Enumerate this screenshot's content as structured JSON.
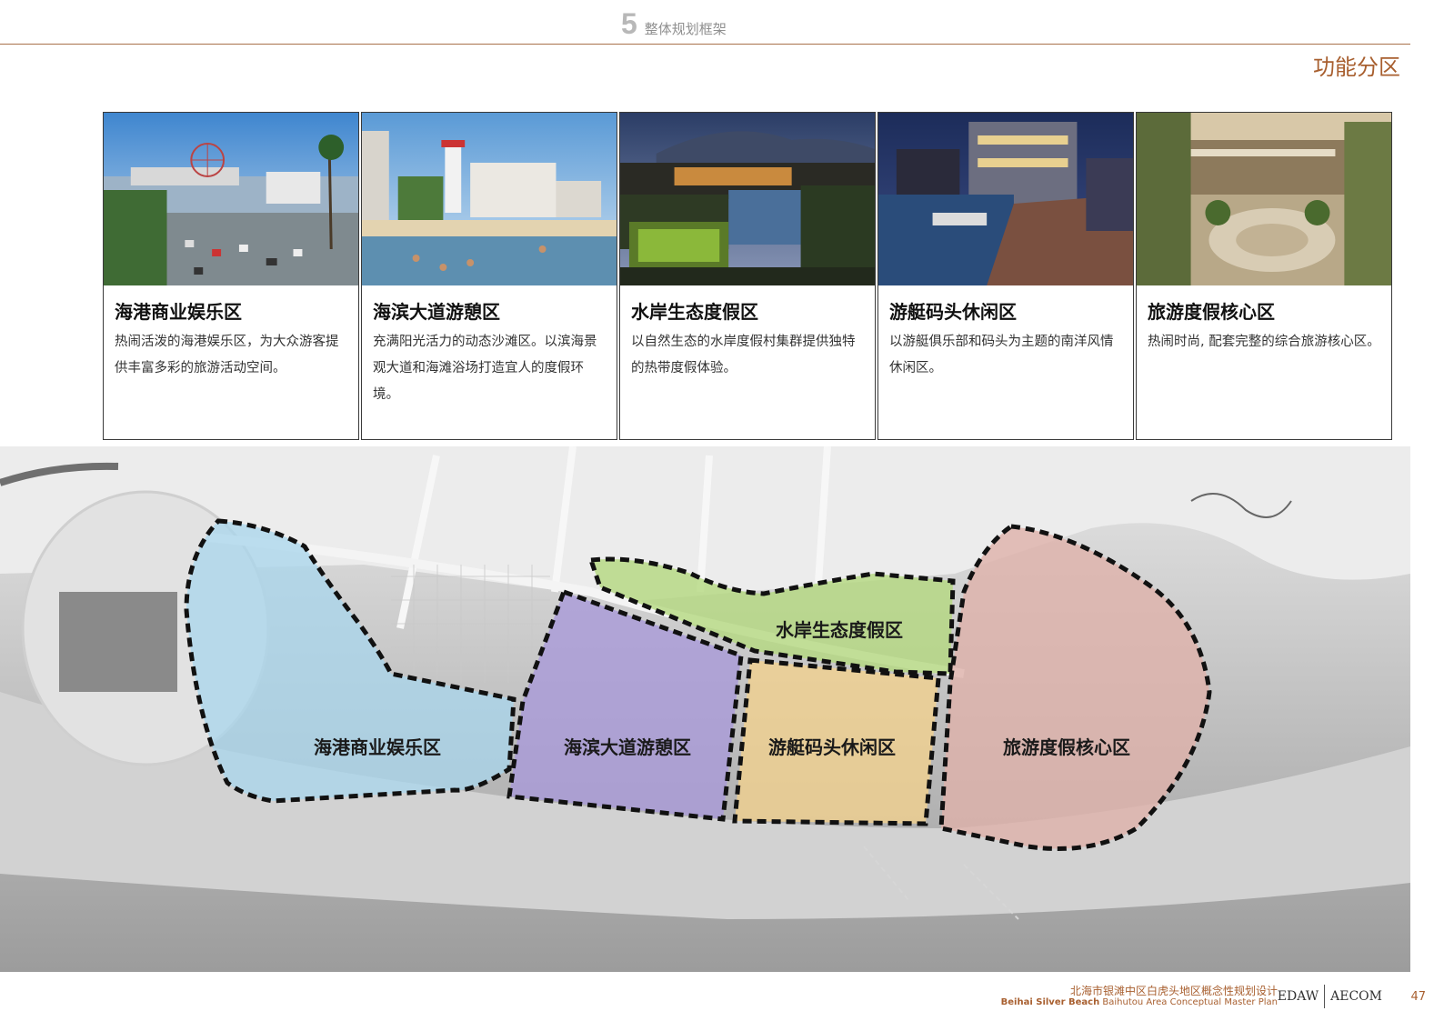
{
  "header": {
    "section_number": "5",
    "section_title": "整体规划框架",
    "page_heading": "功能分区"
  },
  "cards": [
    {
      "title": "海港商业娱乐区",
      "desc": "热闹活泼的海港娱乐区，为大众游客提供丰富多彩的旅游活动空间。",
      "photo": "harbor-pier-ferris-wheel"
    },
    {
      "title": "海滨大道游憩区",
      "desc": "充满阳光活力的动态沙滩区。以滨海景观大道和海滩浴场打造宜人的度假环境。",
      "photo": "beach-resort-hotels"
    },
    {
      "title": "水岸生态度假区",
      "desc": "以自然生态的水岸度假村集群提供独特的热带度假体验。",
      "photo": "waterfront-resort-night"
    },
    {
      "title": "游艇码头休闲区",
      "desc": "以游艇俱乐部和码头为主题的南洋风情休闲区。",
      "photo": "marina-night"
    },
    {
      "title": "旅游度假核心区",
      "desc": "热闹时尚, 配套完整的综合旅游核心区。",
      "photo": "plaza-palms"
    }
  ],
  "map": {
    "zones": [
      {
        "name": "海港商业娱乐区",
        "color": "#a8d6ec"
      },
      {
        "name": "水岸生态度假区",
        "color": "#b4d880"
      },
      {
        "name": "海滨大道游憩区",
        "color": "#a99ad8"
      },
      {
        "name": "游艇码头休闲区",
        "color": "#f1d18f"
      },
      {
        "name": "旅游度假核心区",
        "color": "#dfb2aa"
      }
    ]
  },
  "footer": {
    "title_cn": "北海市银滩中区白虎头地区概念性规划设计",
    "title_en_bold": "Beihai Silver Beach",
    "title_en_rest": " Baihutou Area Conceptual Master Plan",
    "logo_left": "EDAW",
    "logo_right": "AECOM",
    "page_number": "47"
  },
  "colors": {
    "accent": "#a85f2f",
    "rule": "#a9714a"
  }
}
